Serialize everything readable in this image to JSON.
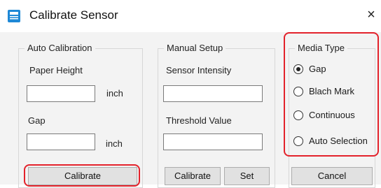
{
  "window": {
    "title": "Calibrate Sensor",
    "close_glyph": "×",
    "icon": "window-app-icon"
  },
  "auto_calibration": {
    "legend": "Auto Calibration",
    "paper_height_label": "Paper Height",
    "paper_height_value": "",
    "paper_height_unit": "inch",
    "gap_label": "Gap",
    "gap_value": "",
    "gap_unit": "inch",
    "calibrate_button": "Calibrate"
  },
  "manual_setup": {
    "legend": "Manual Setup",
    "sensor_intensity_label": "Sensor Intensity",
    "sensor_intensity_value": "",
    "threshold_label": "Threshold Value",
    "threshold_value": "",
    "calibrate_button": "Calibrate",
    "set_button": "Set"
  },
  "media_type": {
    "legend": "Media Type",
    "options": [
      "Gap",
      "Blach Mark",
      "Continuous",
      "Auto Selection"
    ],
    "selected": "Gap",
    "cancel_button": "Cancel"
  },
  "colors": {
    "highlight": "#e3222b",
    "dialog_bg": "#f3f3f3"
  }
}
